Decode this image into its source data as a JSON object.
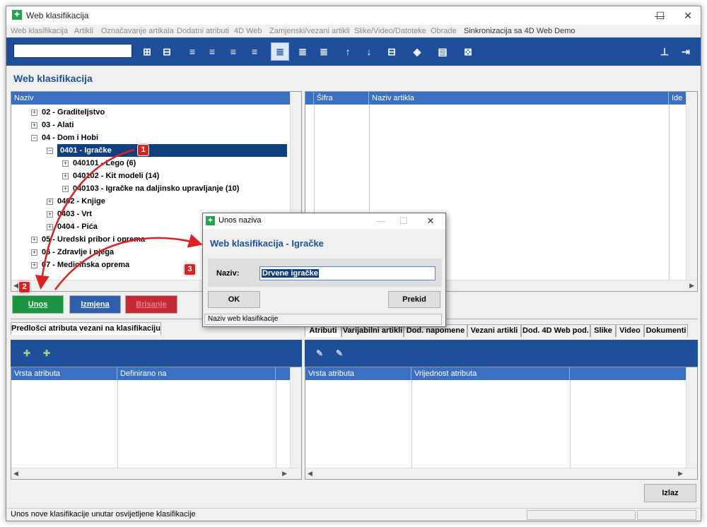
{
  "window": {
    "title": "Web klasifikacija",
    "minimize": "—",
    "maximize": "☐",
    "close": "✕"
  },
  "menu": [
    "Web klasifikacija",
    "Artikli",
    "Označavanje artikala",
    "Dodatni atributi",
    "4D Web",
    "Zamjenski/vezani artikli",
    "Slike/Video/Datoteke",
    "Obrade",
    "Sinkronizacija sa 4D Web Demo"
  ],
  "section_title": "Web klasifikacija",
  "tree": {
    "header": "Naziv",
    "items": [
      {
        "label": "02 - Graditeljstvo"
      },
      {
        "label": "03 - Alati"
      },
      {
        "label": "04 - Dom i Hobi"
      },
      {
        "label": "0401 - Igračke"
      },
      {
        "label": "040101 - Lego (6)"
      },
      {
        "label": "040102 - Kit modeli (14)"
      },
      {
        "label": "040103 - Igračke na daljinsko upravljanje (10)"
      },
      {
        "label": "0402 - Knjige"
      },
      {
        "label": "0403 - Vrt"
      },
      {
        "label": "0404 - Pića"
      },
      {
        "label": "05 - Uredski pribor i oprema"
      },
      {
        "label": "06 - Zdravlje i njega"
      },
      {
        "label": "07 - Medicinska oprema"
      }
    ]
  },
  "articles": {
    "col_sifra": "Šifra",
    "col_naziv": "Naziv artikla",
    "col_ide": "Ide"
  },
  "buttons": {
    "unos": "Unos",
    "izmjena": "Izmjena",
    "brisanje": "Brisanje",
    "izlaz": "Izlaz"
  },
  "left_tab": "Predlošci atributa vezani na klasifikaciju",
  "right_tabs": [
    "Atributi",
    "Varijabilni artikli",
    "Dod. napomene",
    "Vezani artikli",
    "Dod. 4D Web pod.",
    "Slike",
    "Video",
    "Dokumenti"
  ],
  "left_grid": {
    "col1": "Vrsta atributa",
    "col2": "Definirano na"
  },
  "right_grid": {
    "col1": "Vrsta atributa",
    "col2": "Vrijednost atributa"
  },
  "status": "Unos nove klasifikacije unutar osvijetljene klasifikacije",
  "dialog": {
    "title": "Unos naziva",
    "heading": "Web klasifikacija - Igračke",
    "label": "Naziv:",
    "value": "Drvene igračke",
    "ok": "OK",
    "cancel": "Prekid",
    "status": "Naziv web klasifikacije"
  },
  "badges": [
    "1",
    "2",
    "3"
  ],
  "colors": {
    "accent": "#1f4e9a",
    "unos": "#1a9440",
    "izmjena": "#2f5fae",
    "brisanje": "#c42a36",
    "badge": "#e02020"
  }
}
